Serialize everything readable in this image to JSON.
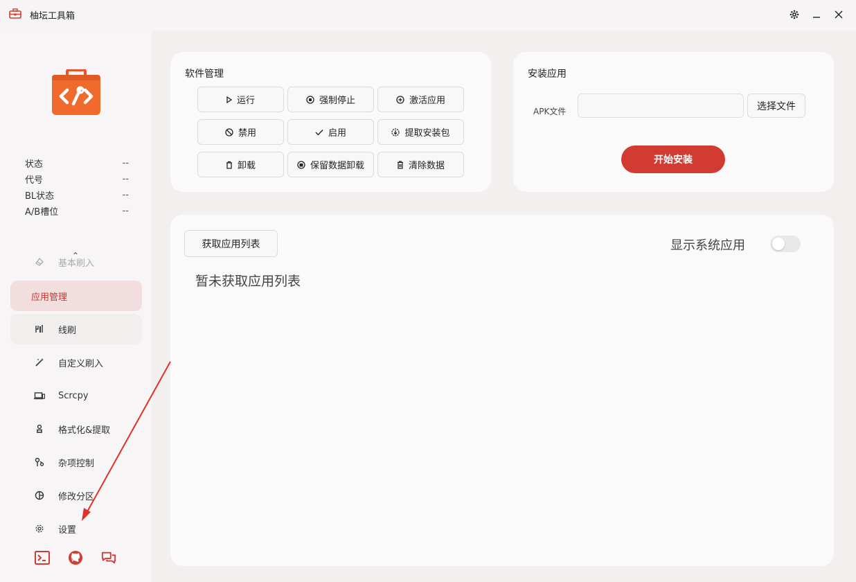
{
  "window": {
    "title": "柚坛工具箱",
    "icons": [
      "toolbox-icon",
      "gear-icon",
      "minimize-icon",
      "close-icon"
    ]
  },
  "sidebar": {
    "status": [
      {
        "label": "状态",
        "value": "--"
      },
      {
        "label": "代号",
        "value": "--"
      },
      {
        "label": "BL状态",
        "value": "--"
      },
      {
        "label": "A/B槽位",
        "value": "--"
      }
    ],
    "items": [
      {
        "label": "基本刷入",
        "icon": "flash-icon"
      },
      {
        "label": "应用管理",
        "icon": ""
      },
      {
        "label": "线刷",
        "icon": "tools-icon"
      },
      {
        "label": "自定义刷入",
        "icon": "wand-icon"
      },
      {
        "label": "Scrcpy",
        "icon": "screen-mirror-icon"
      },
      {
        "label": "格式化&提取",
        "icon": "person-icon"
      },
      {
        "label": "杂项控制",
        "icon": "wrench-icon"
      },
      {
        "label": "修改分区",
        "icon": "pie-chart-icon"
      },
      {
        "label": "设置",
        "icon": "gear-icon"
      }
    ],
    "active_item": "应用管理",
    "bottom_icons": [
      "terminal-icon",
      "github-icon",
      "chat-icon"
    ]
  },
  "software": {
    "title": "软件管理",
    "buttons": [
      {
        "label": "运行",
        "icon": "play-icon"
      },
      {
        "label": "强制停止",
        "icon": "stop-circle-icon"
      },
      {
        "label": "激活应用",
        "icon": "plus-circle-icon"
      },
      {
        "label": "禁用",
        "icon": "ban-icon"
      },
      {
        "label": "启用",
        "icon": "check-icon"
      },
      {
        "label": "提取安装包",
        "icon": "download-circle-icon"
      },
      {
        "label": "卸载",
        "icon": "trash-icon"
      },
      {
        "label": "保留数据卸载",
        "icon": "archive-circle-icon"
      },
      {
        "label": "清除数据",
        "icon": "trash-icon"
      }
    ]
  },
  "install": {
    "title": "安装应用",
    "apk_label": "APK文件",
    "apk_value": "",
    "choose_label": "选择文件",
    "install_label": "开始安装"
  },
  "applist": {
    "get_label": "获取应用列表",
    "show_system_label": "显示系统应用",
    "show_system": false,
    "empty_text": "暂未获取应用列表"
  },
  "colors": {
    "accent": "#d13b31",
    "active_bg": "#f2dede"
  }
}
